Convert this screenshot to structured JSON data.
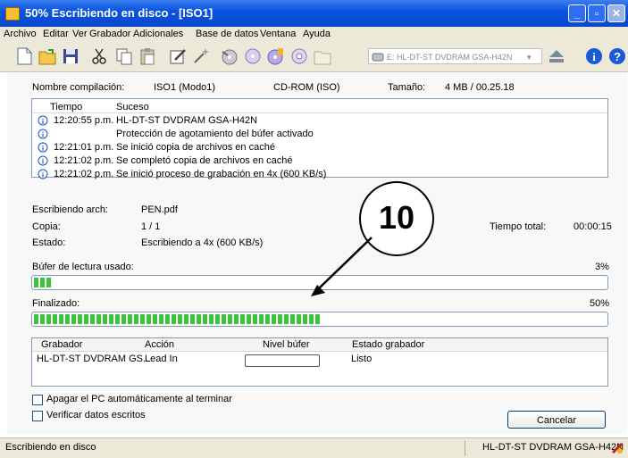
{
  "window": {
    "title": "50% Escribiendo en disco - [ISO1]"
  },
  "menu": [
    "Archivo",
    "Editar",
    "Ver",
    "Grabador",
    "Adicionales",
    "Base de datos",
    "Ventana",
    "Ayuda"
  ],
  "toolbar": {
    "drive": "E: HL-DT-ST DVDRAM GSA-H42N"
  },
  "info": {
    "name_label": "Nombre compilación:",
    "name_value": "ISO1 (Modo1)",
    "type_value": "CD-ROM (ISO)",
    "size_label": "Tamaño:",
    "size_value": "4 MB  /  00.25.18"
  },
  "log": {
    "headers": [
      "Tiempo",
      "Suceso"
    ],
    "rows": [
      {
        "time": "12:20:55 p.m.",
        "event": "HL-DT-ST DVDRAM GSA-H42N"
      },
      {
        "time": "",
        "event": "Protección de agotamiento del búfer activado"
      },
      {
        "time": "12:21:01 p.m.",
        "event": "Se inició copia de archivos en caché"
      },
      {
        "time": "12:21:02 p.m.",
        "event": "Se completó copia de archivos en caché"
      },
      {
        "time": "12:21:02 p.m.",
        "event": "Se inició proceso de grabación en 4x (600 KB/s)"
      }
    ]
  },
  "progress": {
    "writing_label": "Escribiendo arch:",
    "writing_value": "PEN.pdf",
    "copy_label": "Copia:",
    "copy_value": "1 / 1",
    "status_label": "Estado:",
    "status_value": "Escribiendo a 4x (600 KB/s)",
    "total_label": "Tiempo total:",
    "total_value": "00:00:15",
    "buffer_label": "Búfer de lectura usado:",
    "buffer_pct": "3%",
    "buffer_fraction": 0.03,
    "done_label": "Finalizado:",
    "done_pct": "50%",
    "done_fraction": 0.5
  },
  "callout": {
    "number": "10"
  },
  "recorders": {
    "headers": [
      "Grabador",
      "Acción",
      "Nivel búfer",
      "Estado grabador"
    ],
    "row": {
      "recorder": "HL-DT-ST DVDRAM GS...",
      "action": "Lead In",
      "status": "Listo"
    }
  },
  "options": {
    "shutdown": "Apagar el PC automáticamente al terminar",
    "verify": "Verificar datos escritos",
    "cancel": "Cancelar"
  },
  "statusbar": {
    "left": "Escribiendo en disco",
    "right": "HL-DT-ST DVDRAM GSA-H42N"
  },
  "colors": {
    "titlebar": "#0a54e0",
    "progress": "#3bc43b"
  }
}
